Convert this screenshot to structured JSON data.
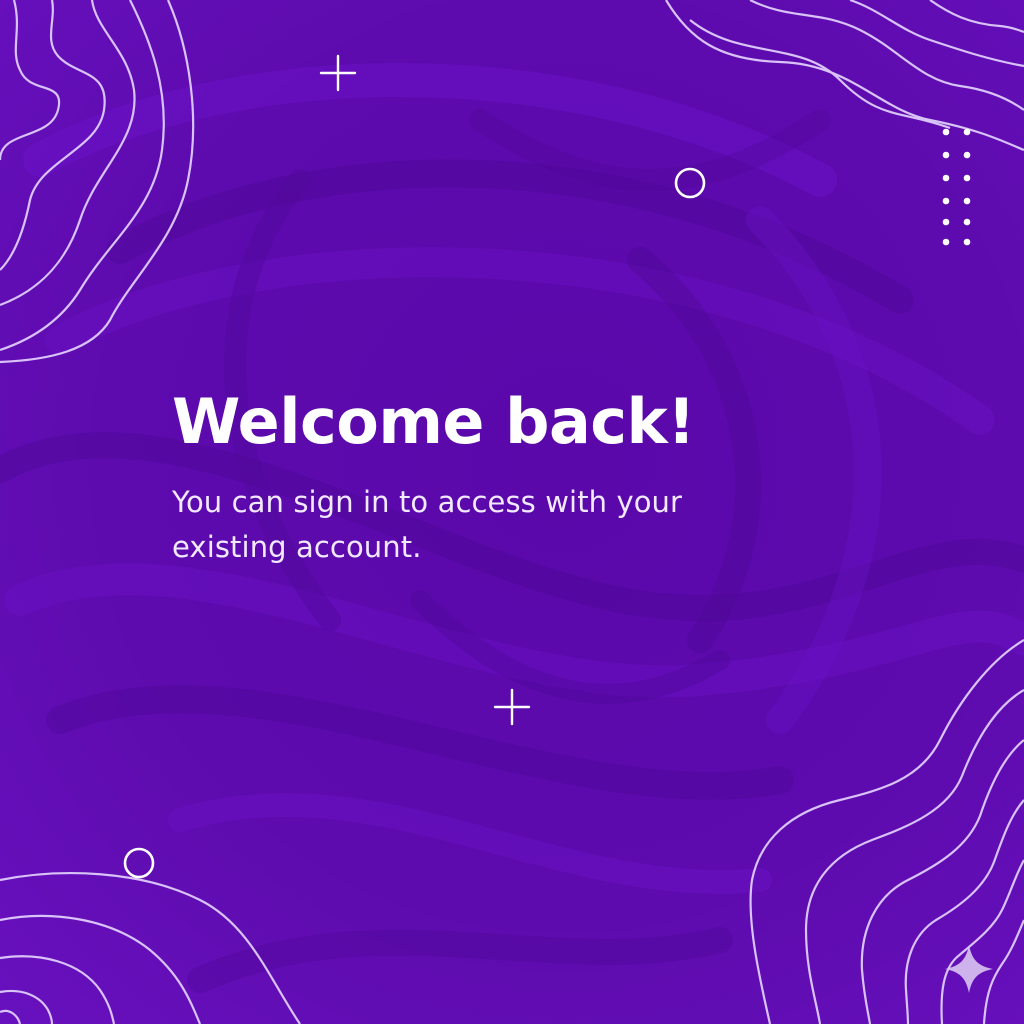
{
  "welcome": {
    "title": "Welcome back!",
    "subtitle": "You can sign in to access with your existing account."
  },
  "theme": {
    "background": "#5a0aa8",
    "background_light": "#6a10c4",
    "background_dark": "#4e0696",
    "line_color": "#e6d6ff",
    "text_color": "#ffffff"
  },
  "decorations": {
    "icons": [
      "plus-icon",
      "ring-icon",
      "dot-grid-icon",
      "sparkle-icon"
    ]
  }
}
